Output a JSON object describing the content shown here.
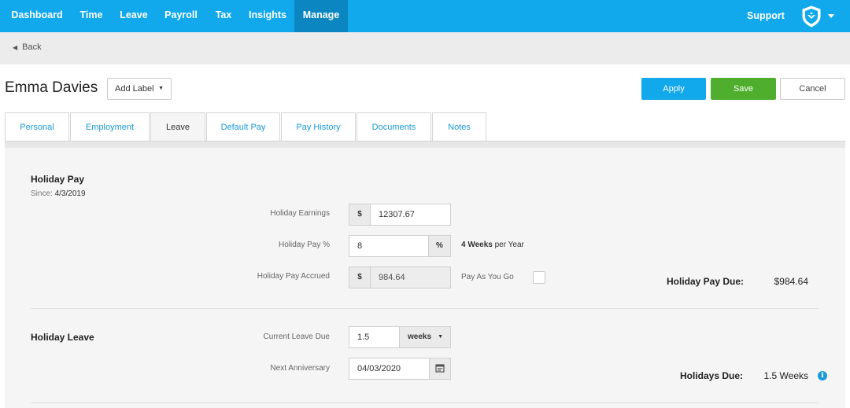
{
  "nav": {
    "items": [
      {
        "label": "Dashboard"
      },
      {
        "label": "Time"
      },
      {
        "label": "Leave"
      },
      {
        "label": "Payroll"
      },
      {
        "label": "Tax"
      },
      {
        "label": "Insights"
      },
      {
        "label": "Manage"
      }
    ],
    "active": "Manage",
    "support_label": "Support",
    "colors": {
      "bar": "#11a8ec",
      "active": "#0c86c0"
    }
  },
  "back_label": "Back",
  "header": {
    "name": "Emma Davies",
    "add_label": "Add Label",
    "apply_label": "Apply",
    "save_label": "Save",
    "cancel_label": "Cancel"
  },
  "tabs": [
    {
      "label": "Personal"
    },
    {
      "label": "Employment"
    },
    {
      "label": "Leave"
    },
    {
      "label": "Default Pay"
    },
    {
      "label": "Pay History"
    },
    {
      "label": "Documents"
    },
    {
      "label": "Notes"
    }
  ],
  "active_tab": "Leave",
  "holiday_pay": {
    "title": "Holiday Pay",
    "since_label": "Since:",
    "since_value": "4/3/2019",
    "earnings_label": "Holiday Earnings",
    "earnings_prefix": "$",
    "earnings_value": "12307.67",
    "pct_label": "Holiday Pay %",
    "pct_value": "8",
    "pct_suffix": "%",
    "weeks_bold": "4 Weeks",
    "weeks_rest": "per Year",
    "accrued_label": "Holiday Pay Accrued",
    "accrued_prefix": "$",
    "accrued_value": "984.64",
    "payasyougo_label": "Pay As You Go",
    "payasyougo_checked": false,
    "due_label": "Holiday Pay Due:",
    "due_value": "$984.64"
  },
  "holiday_leave": {
    "title": "Holiday Leave",
    "current_due_label": "Current Leave Due",
    "current_due_value": "1.5",
    "unit_selected": "weeks",
    "anniversary_label": "Next Anniversary",
    "anniversary_value": "04/03/2020",
    "due_label": "Holidays Due:",
    "due_value": "1.5 Weeks"
  },
  "icons": {
    "back": "caret-left-icon",
    "logo": "shield-logo-icon",
    "dropdown": "chevron-down-icon",
    "calendar": "calendar-icon",
    "info": "info-icon"
  }
}
